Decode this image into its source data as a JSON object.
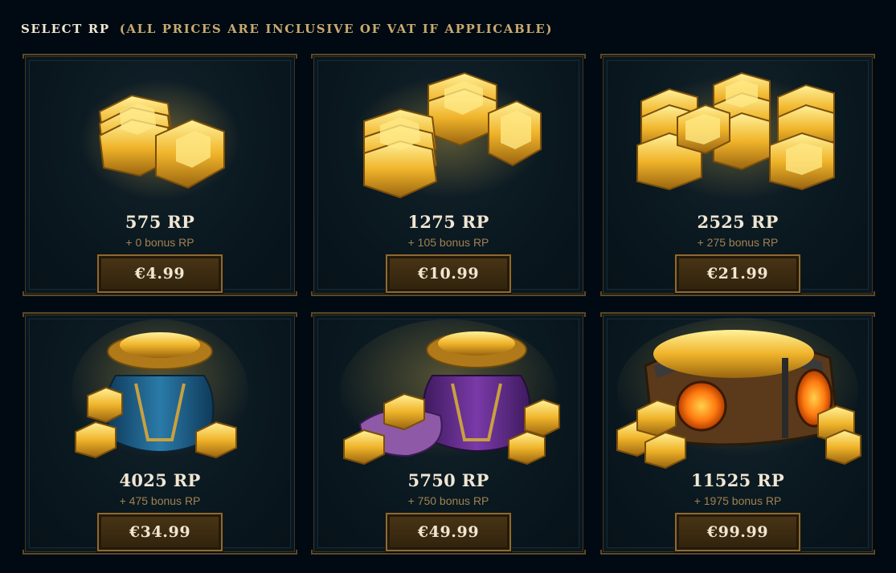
{
  "header": {
    "title": "SELECT RP",
    "note": "(ALL PRICES ARE INCLUSIVE OF VAT IF APPLICABLE)"
  },
  "colors": {
    "background": "#010a13",
    "card": "#081821",
    "gold_border": "#463714",
    "gold_text": "#c8aa6e",
    "button": "#3a2a10",
    "text_light": "#f0e6d2"
  },
  "bundles": [
    {
      "rp": "575 RP",
      "bonus": "+ 0 bonus RP",
      "price": "€4.99",
      "art": "coin-stack-small-icon"
    },
    {
      "rp": "1275 RP",
      "bonus": "+ 105 bonus RP",
      "price": "€10.99",
      "art": "coin-stack-medium-icon"
    },
    {
      "rp": "2525 RP",
      "bonus": "+ 275 bonus RP",
      "price": "€21.99",
      "art": "coin-stack-large-icon"
    },
    {
      "rp": "4025 RP",
      "bonus": "+ 475 bonus RP",
      "price": "€34.99",
      "art": "blue-coin-bag-icon"
    },
    {
      "rp": "5750 RP",
      "bonus": "+ 750 bonus RP",
      "price": "€49.99",
      "art": "purple-coin-bag-icon"
    },
    {
      "rp": "11525 RP",
      "bonus": "+ 1975 bonus RP",
      "price": "€99.99",
      "art": "treasure-chest-icon"
    }
  ]
}
